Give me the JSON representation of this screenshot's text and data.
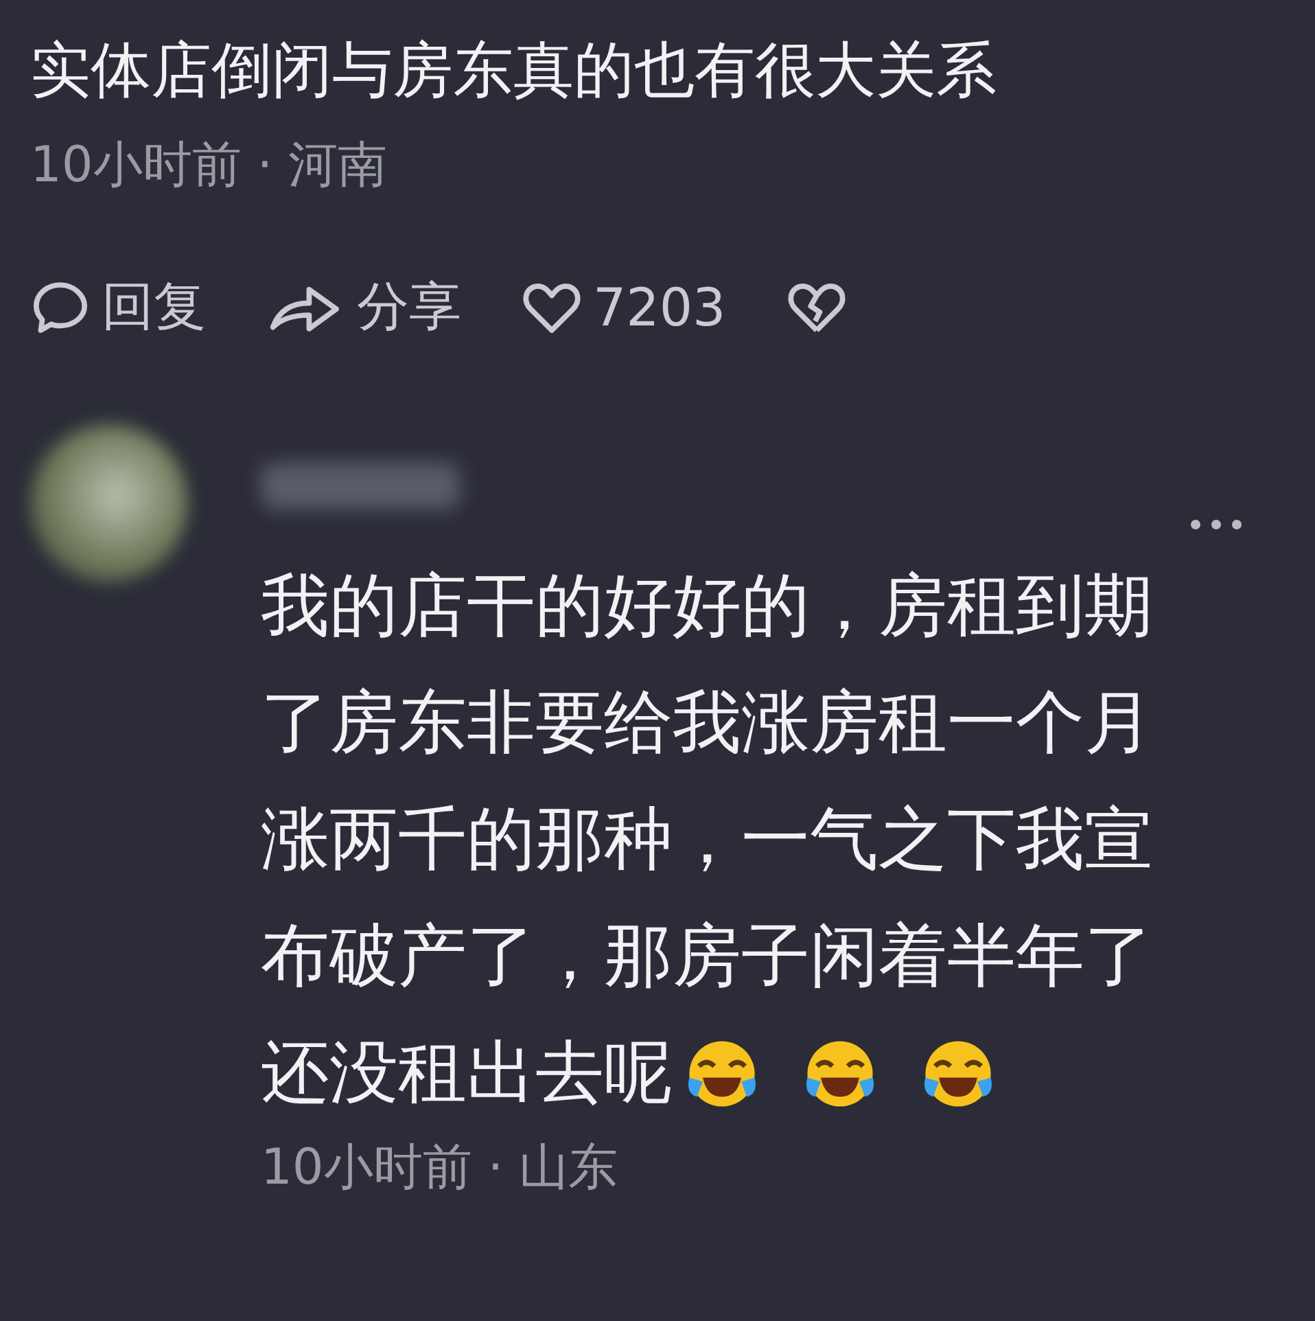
{
  "post": {
    "title": "实体店倒闭与房东真的也有很大关系",
    "meta": "10小时前 · 河南"
  },
  "actions": [
    {
      "kind": "reply",
      "label": "回复"
    },
    {
      "kind": "share",
      "label": "分享"
    },
    {
      "kind": "like",
      "label": "7203"
    },
    {
      "kind": "dislike"
    }
  ],
  "reply": {
    "lines": [
      "我的店干的好好的，房租到期",
      "了房东非要给我涨房租一个月",
      "涨两千的那种，一气之下我宣",
      "布破产了，那房子闲着半年了",
      "还没租出去呢"
    ],
    "meta": "10小时前 · 山东"
  }
}
